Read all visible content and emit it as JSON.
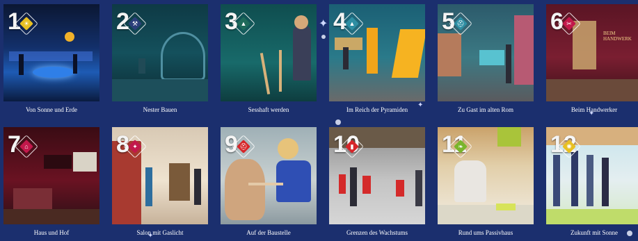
{
  "tiles": [
    {
      "number": "1",
      "label": "Von Sonne und Erde",
      "icon": "sun-icon",
      "badge_color": "#e8c022",
      "glyph": "☀"
    },
    {
      "number": "2",
      "label": "Nester Bauen",
      "icon": "bone-icon",
      "badge_color": "#2b3f7a",
      "glyph": "⚒"
    },
    {
      "number": "3",
      "label": "Sesshaft werden",
      "icon": "tent-icon",
      "badge_color": "#1f6a5a",
      "glyph": "▲"
    },
    {
      "number": "4",
      "label": "Im Reich der Pyramiden",
      "icon": "pyramid-icon",
      "badge_color": "#2e8ea3",
      "glyph": "▲"
    },
    {
      "number": "5",
      "label": "Zu Gast im alten Rom",
      "icon": "helmet-icon",
      "badge_color": "#2e8ea3",
      "glyph": "⛑"
    },
    {
      "number": "6",
      "label": "Beim Handwerker",
      "icon": "tool-icon",
      "badge_color": "#c2184b",
      "glyph": "✂"
    },
    {
      "number": "7",
      "label": "Haus und Hof",
      "icon": "house-icon",
      "badge_color": "#c2184b",
      "glyph": "⌂"
    },
    {
      "number": "8",
      "label": "Salon mit Gaslicht",
      "icon": "lamp-icon",
      "badge_color": "#c2184b",
      "glyph": "✦"
    },
    {
      "number": "9",
      "label": "Auf der Baustelle",
      "icon": "hardhat-icon",
      "badge_color": "#d6262a",
      "glyph": "⛑"
    },
    {
      "number": "10",
      "label": "Grenzen des Wachstums",
      "icon": "bar-growth-icon",
      "badge_color": "#d6262a",
      "glyph": "▮"
    },
    {
      "number": "11",
      "label": "Rund ums Passivhaus",
      "icon": "leaf-icon",
      "badge_color": "#7ab52b",
      "glyph": "❧"
    },
    {
      "number": "12",
      "label": "Zukunft mit Sonne",
      "icon": "sun-icon",
      "badge_color": "#e8c022",
      "glyph": "✺"
    }
  ]
}
